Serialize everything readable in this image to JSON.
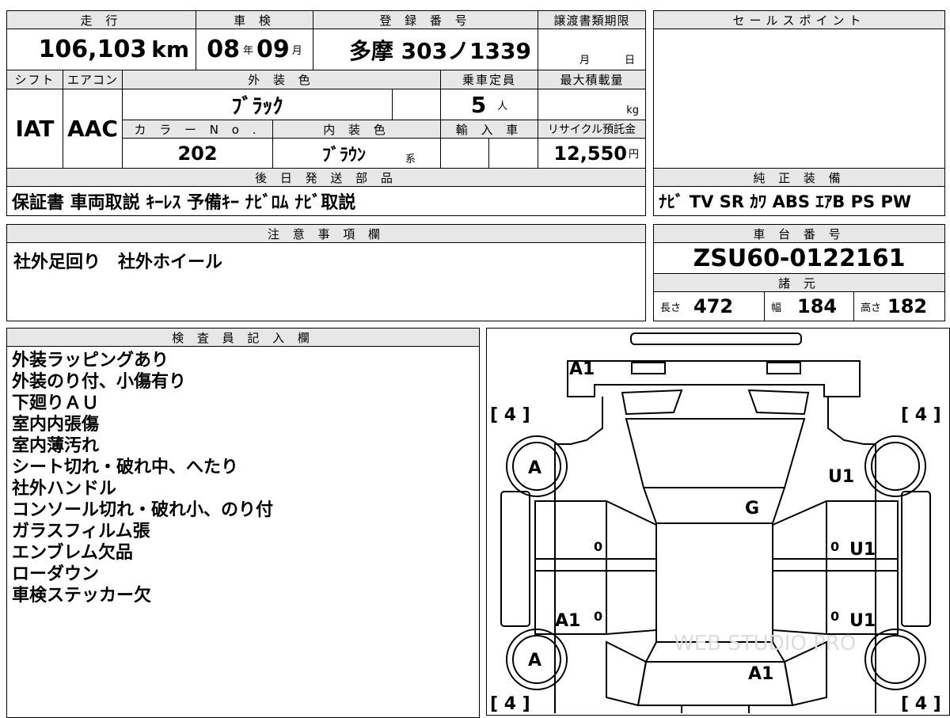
{
  "header": {
    "mileage_label": "走 行",
    "shaken_label": "車 検",
    "registration_label": "登 録 番 号",
    "transfer_label": "譲渡書類期限",
    "sales_point_label": "セールスポイント",
    "shift_label": "シフト",
    "ac_label": "エアコン",
    "exterior_color_label": "外 装 色",
    "capacity_label": "乗車定員",
    "max_load_label": "最大積載量",
    "color_no_label": "カ ラ ー N o .",
    "interior_color_label": "内 装 色",
    "import_label": "輸 入 車",
    "recycle_label": "リサイクル預託金",
    "later_parts_label": "後 日 発 送 部 品",
    "genuine_equipment_label": "純 正 装 備",
    "caution_label": "注 意 事 項 欄",
    "chassis_label": "車 台 番 号",
    "specs_label": "諸 元",
    "inspector_label": "検 査 員 記 入 欄"
  },
  "vehicle": {
    "mileage": "106,103",
    "mileage_unit": "km",
    "shaken_year": "08",
    "year_unit": "年",
    "shaken_month": "09",
    "month_unit": "月",
    "registration": "多摩 303ノ1339",
    "transfer_month_unit": "月",
    "transfer_day_unit": "日",
    "shift": "IAT",
    "ac": "AAC",
    "exterior_color": "ﾌﾞﾗｯｸ",
    "capacity": "5",
    "capacity_unit": "人",
    "load_unit": "kg",
    "color_no": "202",
    "interior_color": "ﾌﾞﾗｳﾝ",
    "interior_suffix": "系",
    "recycle_fee": "12,550",
    "recycle_unit": "円",
    "later_parts": "保証書 車両取説 ｷｰﾚｽ 予備ｷｰ ﾅﾋﾞﾛﾑ ﾅﾋﾞ取説",
    "genuine_equipment": "ﾅﾋﾞ TV SR ｶﾜ ABS ｴｱB PS PW",
    "caution": "社外足回り　社外ホイール",
    "chassis_number": "ZSU60-0122161",
    "length_label": "長さ",
    "length": "472",
    "width_label": "幅",
    "width": "184",
    "height_label": "高さ",
    "height": "182"
  },
  "inspector_notes": [
    "外装ラッピングあり",
    "外装のり付、小傷有り",
    "下廻りＡＵ",
    "室内内張傷",
    "室内薄汚れ",
    "シート切れ・破れ中、へたり",
    "社外ハンドル",
    "コンソール切れ・破れ小、のり付",
    "ガラスフィルム張",
    "エンブレム欠品",
    "ローダウン",
    "車検ステッカー欠"
  ],
  "diagram": {
    "tire_tl": "[ 4 ]",
    "tire_tr": "[ 4 ]",
    "tire_bl": "[ 4 ]",
    "tire_br": "[ 4 ]",
    "mark_front_bumper": "A1",
    "mark_wheel_fl": "A",
    "mark_wheel_rl": "A",
    "mark_front_right": "U1",
    "mark_hood": "G",
    "mark_right_door_front": "U1",
    "mark_left_rear": "A1",
    "mark_right_door_rear": "U1",
    "mark_roof_rear": "A1",
    "zero_1": "0",
    "zero_2": "0",
    "zero_3": "0",
    "zero_4": "0",
    "watermark": "WEB STUDIO PRO"
  }
}
